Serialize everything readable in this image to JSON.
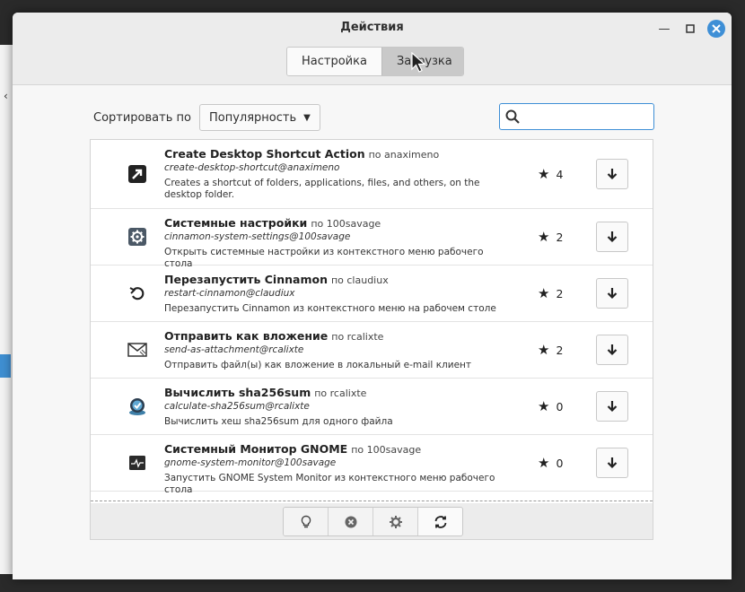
{
  "window": {
    "title": "Действия"
  },
  "tabs": [
    {
      "label": "Настройка",
      "active": false
    },
    {
      "label": "Загрузка",
      "active": true
    }
  ],
  "sort": {
    "label": "Сортировать по",
    "selected": "Популярность"
  },
  "search": {
    "value": "",
    "placeholder": ""
  },
  "actions": [
    {
      "name": "Create Desktop Shortcut Action",
      "by": "по anaximeno",
      "uuid": "create-desktop-shortcut@anaximeno",
      "description": "Creates a shortcut of folders, applications, files, and others, on the desktop folder.",
      "rating": "4",
      "icon": "arrow-shortcut-icon"
    },
    {
      "name": "Системные настройки",
      "by": "по 100savage",
      "uuid": "cinnamon-system-settings@100savage",
      "description": "Открыть системные настройки из контекстного меню рабочего стола",
      "rating": "2",
      "icon": "settings-gear-icon"
    },
    {
      "name": "Перезапустить Cinnamon",
      "by": "по claudiux",
      "uuid": "restart-cinnamon@claudiux",
      "description": "Перезапустить Cinnamon из контекстного меню на рабочем столе",
      "rating": "2",
      "icon": "restart-icon"
    },
    {
      "name": "Отправить как вложение",
      "by": "по rcalixte",
      "uuid": "send-as-attachment@rcalixte",
      "description": "Отправить файл(ы) как вложение в локальный e-mail клиент",
      "rating": "2",
      "icon": "mail-attachment-icon"
    },
    {
      "name": "Вычислить sha256sum",
      "by": "по rcalixte",
      "uuid": "calculate-sha256sum@rcalixte",
      "description": "Вычислить хеш sha256sum для одного файла",
      "rating": "0",
      "icon": "checksum-badge-icon"
    },
    {
      "name": "Системный Монитор GNOME",
      "by": "по 100savage",
      "uuid": "gnome-system-monitor@100savage",
      "description": "Запустить GNOME System Monitor из контекстного меню рабочего стола",
      "rating": "0",
      "icon": "system-monitor-icon"
    }
  ],
  "toolbar": {
    "buttons": [
      "lightbulb-icon",
      "remove-icon",
      "gear-icon",
      "refresh-icon"
    ]
  },
  "colors": {
    "accent": "#3e8fd6"
  }
}
